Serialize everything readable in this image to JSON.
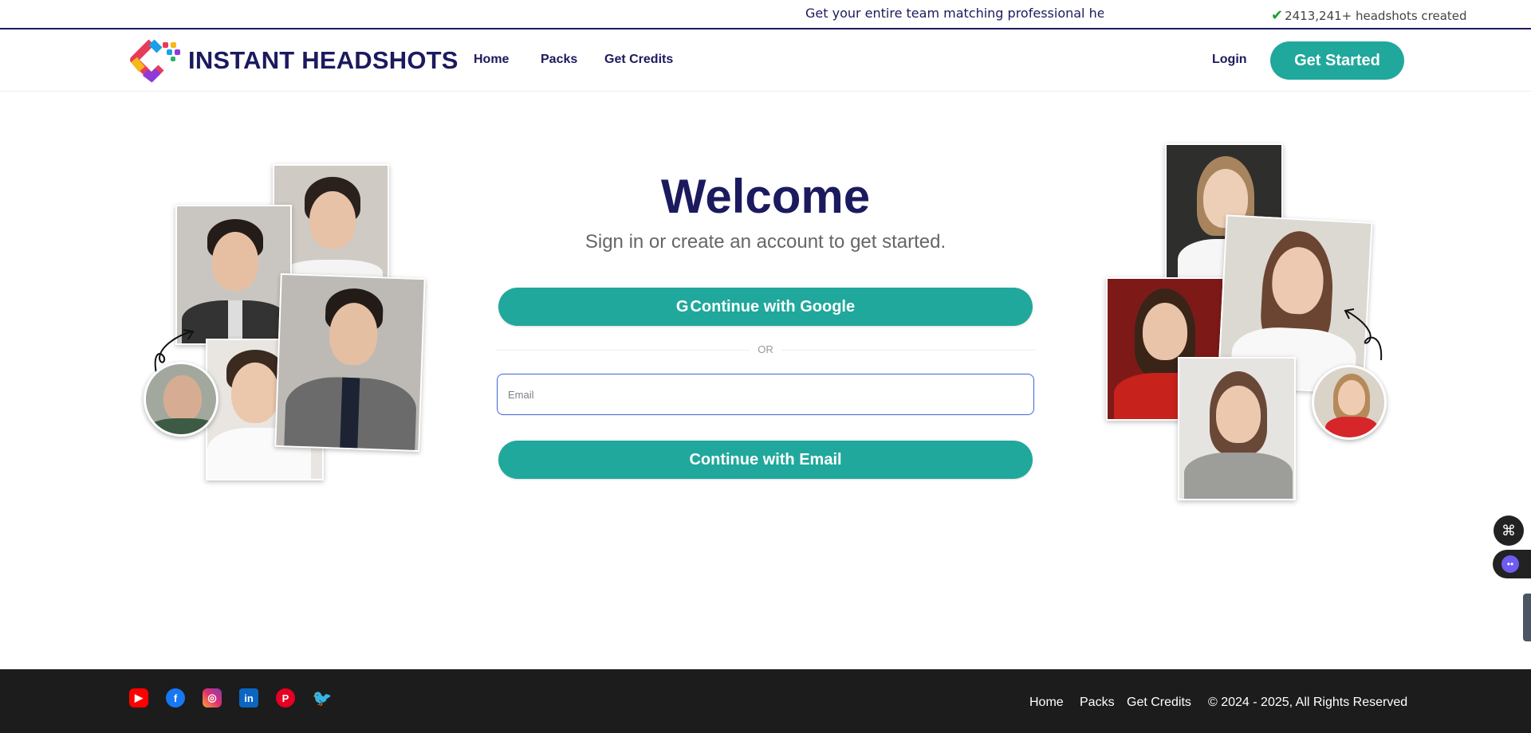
{
  "topbar": {
    "ticker_text": "Get your entire team matching professional headshots",
    "counter_text": "2413,241+ headshots created"
  },
  "nav": {
    "brand": "INSTANT HEADSHOTS",
    "links": [
      "Home",
      "Packs",
      "Get Credits"
    ],
    "login": "Login",
    "get_started": "Get Started"
  },
  "auth": {
    "title": "Welcome",
    "subtitle": "Sign in or create an account to get started.",
    "google_icon": "G",
    "google_button": "Continue with Google",
    "or_text": "OR",
    "email_placeholder": "Email",
    "email_button": "Continue with Email"
  },
  "footer": {
    "social": [
      "youtube-icon",
      "facebook-icon",
      "instagram-icon",
      "linkedin-icon",
      "pinterest-icon",
      "twitter-icon"
    ],
    "links": [
      "Home",
      "Packs",
      "Get Credits"
    ],
    "copyright": "© 2024 - 2025, All Rights Reserved"
  },
  "colors": {
    "brand_navy": "#1c1a5e",
    "accent_teal": "#20a89c",
    "footer_bg": "#1c1c1c"
  }
}
